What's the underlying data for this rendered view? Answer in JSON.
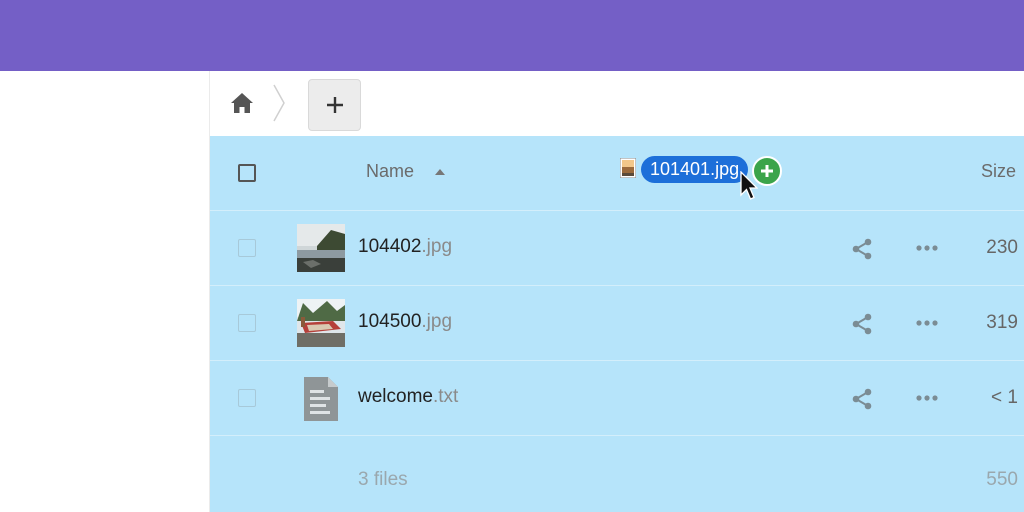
{
  "header": {
    "accent_color": "#745fc6"
  },
  "breadcrumb": {
    "home_icon": "home-icon",
    "separator_icon": "chevron-right-icon",
    "new_button_icon": "plus-icon"
  },
  "table": {
    "header": {
      "name_label": "Name",
      "size_label": "Size",
      "sort_icon": "sort-ascending-icon"
    },
    "rows": [
      {
        "basename": "104402",
        "ext": ".jpg",
        "size": "230",
        "thumb": "landscape-photo"
      },
      {
        "basename": "104500",
        "ext": ".jpg",
        "size": "319",
        "thumb": "boat-photo"
      },
      {
        "basename": "welcome",
        "ext": ".txt",
        "size": "< 1",
        "thumb": "text-file-icon"
      }
    ],
    "summary": {
      "count_label": "3 files",
      "total_size": "550"
    }
  },
  "drag": {
    "filename": "101401.jpg",
    "add_icon": "plus-icon",
    "cursor": "arrow-cursor"
  },
  "colors": {
    "selection_bg": "#b6e4fa",
    "drag_label_bg": "#1d6fd9",
    "add_badge": "#3ba44a"
  }
}
